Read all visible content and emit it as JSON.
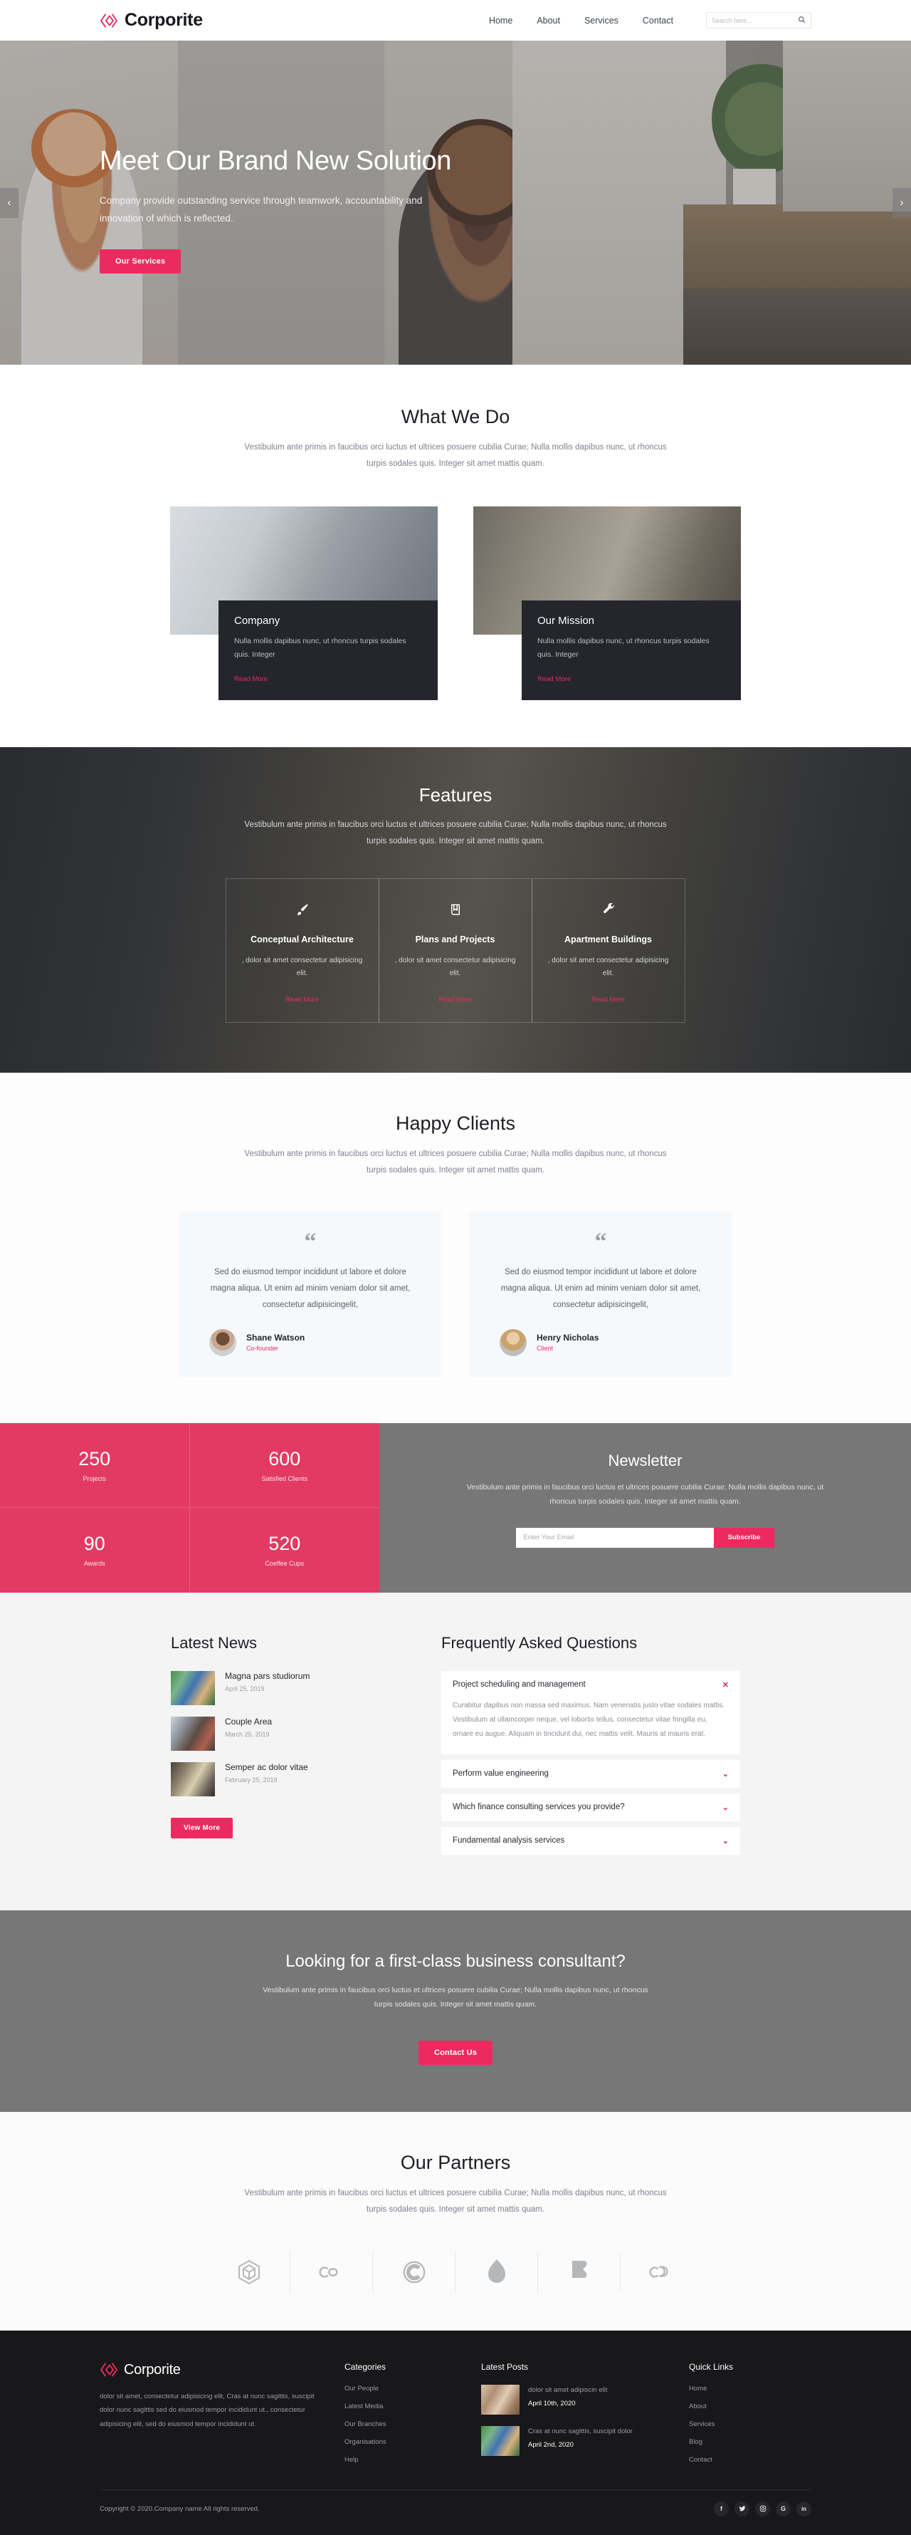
{
  "brand": {
    "name": "Corporite",
    "logo_icon": "diamond-chevrons-logo",
    "accent": "#ed2a5f"
  },
  "header": {
    "nav": [
      {
        "label": "Home"
      },
      {
        "label": "About"
      },
      {
        "label": "Services"
      },
      {
        "label": "Contact"
      }
    ],
    "search": {
      "placeholder": "Search here...",
      "icon": "search-icon"
    }
  },
  "hero": {
    "title": "Meet Our Brand New Solution",
    "subtitle": "Company provide outstanding service through teamwork, accountability and innovation of which is reflected.",
    "cta_label": "Our Services",
    "prev_icon": "chevron-left-icon",
    "next_icon": "chevron-right-icon"
  },
  "what_we_do": {
    "title": "What We Do",
    "subtitle": "Vestibulum ante primis in faucibus orci luctus et ultrices posuere cubilia Curae; Nulla mollis dapibus nunc, ut rhoncus turpis sodales quis. Integer sit amet mattis quam.",
    "cards": [
      {
        "title": "Company",
        "text": "Nulla mollis dapibus nunc, ut rhoncus turpis sodales quis. Integer",
        "link": "Read More"
      },
      {
        "title": "Our Mission",
        "text": "Nulla mollis dapibus nunc, ut rhoncus turpis sodales quis. Integer",
        "link": "Read More"
      }
    ]
  },
  "features": {
    "title": "Features",
    "subtitle": "Vestibulum ante primis in faucibus orci luctus et ultrices posuere cubilia Curae; Nulla mollis dapibus nunc, ut rhoncus turpis sodales quis. Integer sit amet mattis quam.",
    "items": [
      {
        "icon": "paint-brush-icon",
        "title": "Conceptual Architecture",
        "text": ", dolor sit amet consectetur adipisicing elit.",
        "link": "Read More"
      },
      {
        "icon": "book-icon",
        "title": "Plans and Projects",
        "text": ", dolor sit amet consectetur adipisicing elit.",
        "link": "Read More"
      },
      {
        "icon": "wrench-icon",
        "title": "Apartment Buildings",
        "text": ", dolor sit amet consectetur adipisicing elit.",
        "link": "Read More"
      }
    ]
  },
  "clients": {
    "title": "Happy Clients",
    "subtitle": "Vestibulum ante primis in faucibus orci luctus et ultrices posuere cubilia Curae; Nulla mollis dapibus nunc, ut rhoncus turpis sodales quis. Integer sit amet mattis quam.",
    "testimonials": [
      {
        "quote_icon": "quote-icon",
        "text": "Sed do eiusmod tempor incididunt ut labore et dolore magna aliqua. Ut enim ad minim veniam dolor sit amet, consectetur adipisicingelit,",
        "name": "Shane Watson",
        "role": "Co-founder"
      },
      {
        "quote_icon": "quote-icon",
        "text": "Sed do eiusmod tempor incididunt ut labore et dolore magna aliqua. Ut enim ad minim veniam dolor sit amet, consectetur adipisicingelit,",
        "name": "Henry Nicholas",
        "role": "Client"
      }
    ]
  },
  "stats": [
    {
      "number": "250",
      "label": "Projects"
    },
    {
      "number": "600",
      "label": "Satisfied Clients"
    },
    {
      "number": "90",
      "label": "Awards"
    },
    {
      "number": "520",
      "label": "Coeffee Cups"
    }
  ],
  "newsletter": {
    "title": "Newsletter",
    "subtitle": "Vestibulum ante primis in faucibus orci luctus et ultrices posuere cubilia Curae; Nulla mollis dapibus nunc, ut rhoncus turpis sodales quis. Integer sit amet mattis quam.",
    "placeholder": "Enter Your Email",
    "button": "Subscribe"
  },
  "news": {
    "title": "Latest News",
    "items": [
      {
        "title": "Magna pars studiorum",
        "date": "April 25, 2019"
      },
      {
        "title": "Couple Area",
        "date": "March 25, 2019"
      },
      {
        "title": "Semper ac dolor vitae",
        "date": "February 25, 2019"
      }
    ],
    "button": "View More"
  },
  "faq": {
    "title": "Frequently Asked Questions",
    "items": [
      {
        "question": "Project scheduling and management",
        "answer": "Curabitur dapibus non massa sed maximus. Nam venenatis justo vitae sodales mattis. Vestibulum at ullamcorper neque, vel lobortis tellus. consectetur vitae fringilla eu, ornare eu augue. Aliquam in tincidunt dui, nec mattis velit. Mauris at mauris erat.",
        "open": true,
        "icon": "close-icon"
      },
      {
        "question": "Perform value engineering",
        "answer": "",
        "open": false,
        "icon": "chevron-down-icon"
      },
      {
        "question": "Which finance consulting services you provide?",
        "answer": "",
        "open": false,
        "icon": "chevron-down-icon"
      },
      {
        "question": "Fundamental analysis services",
        "answer": "",
        "open": false,
        "icon": "chevron-down-icon"
      }
    ]
  },
  "cta": {
    "title": "Looking for a first-class business consultant?",
    "subtitle": "Vestibulum ante primis in faucibus orci luctus et ultrices posuere cubilia Curae; Nulla mollis dapibus nunc, ut rhoncus turpis sodales quis. Integer sit amet mattis quam.",
    "button": "Contact Us"
  },
  "partners": {
    "title": "Our Partners",
    "subtitle": "Vestibulum ante primis in faucibus orci luctus et ultrices posuere cubilia Curae; Nulla mollis dapibus nunc, ut rhoncus turpis sodales quis. Integer sit amet mattis quam.",
    "logos": [
      {
        "icon": "cube-outline-logo"
      },
      {
        "icon": "lastfm-logo"
      },
      {
        "icon": "c-circle-logo"
      },
      {
        "icon": "drupal-droplet-logo"
      },
      {
        "icon": "joomla-logo"
      },
      {
        "icon": "cloud-loop-logo"
      }
    ]
  },
  "footer": {
    "about": {
      "text": "dolor sit amet, consectetur adipisicing elit, Cras at nunc sagittis, suscipit dolor nunc sagittis sed do eiusmod tempor incididunt ut., consectetur adipisicing elit, sed do eiusmod tempor incididunt ut."
    },
    "categories": {
      "title": "Categories",
      "links": [
        {
          "label": "Our People"
        },
        {
          "label": "Latest Media"
        },
        {
          "label": "Our Branches"
        },
        {
          "label": "Organisations"
        },
        {
          "label": "Help"
        }
      ]
    },
    "latest_posts": {
      "title": "Latest Posts",
      "items": [
        {
          "text": "dolor sit amet adipiscin elit",
          "date": "April 10th, 2020"
        },
        {
          "text": "Cras at nunc sagittis, suscipit dolor",
          "date": "April 2nd, 2020"
        }
      ]
    },
    "quick_links": {
      "title": "Quick Links",
      "links": [
        {
          "label": "Home"
        },
        {
          "label": "About"
        },
        {
          "label": "Services"
        },
        {
          "label": "Blog"
        },
        {
          "label": "Contact"
        }
      ]
    },
    "copyright": "Copyright © 2020.Company name All rights reserved.",
    "socials": [
      {
        "icon": "facebook-icon",
        "glyph": "f"
      },
      {
        "icon": "twitter-icon",
        "glyph": "🐦"
      },
      {
        "icon": "instagram-icon",
        "glyph": "◎"
      },
      {
        "icon": "google-plus-icon",
        "glyph": "G"
      },
      {
        "icon": "linkedin-icon",
        "glyph": "in"
      }
    ]
  }
}
